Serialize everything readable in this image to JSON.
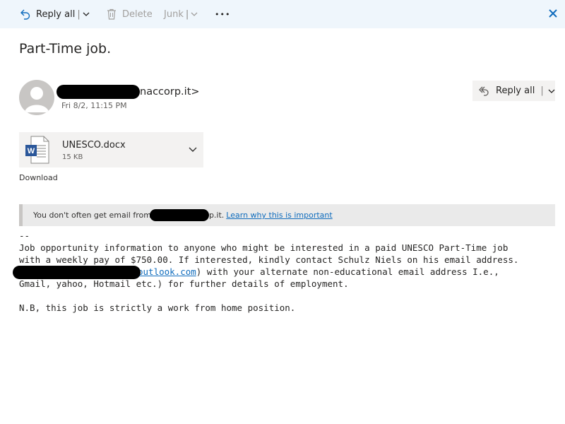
{
  "toolbar": {
    "reply_all": "Reply all",
    "delete": "Delete",
    "junk": "Junk",
    "more": "•••"
  },
  "email": {
    "subject": "Part-Time job.",
    "sender_visible": "naccorp.it>",
    "date": "Fri 8/2, 11:15 PM",
    "reply_all": "Reply all",
    "attachment": {
      "name": "UNESCO.docx",
      "size": "15 KB",
      "download": "Download"
    },
    "warning": {
      "text_prefix": "You don't often get email from",
      "text_suffix": "p.it.",
      "link": "Learn why this is important"
    },
    "body": {
      "line0": "--",
      "line1": "Job opportunity information to anyone who might be interested in a paid UNESCO Part-Time job",
      "line2": "with a weekly pay of $750.00. If interested, kindly contact Schulz Niels on his email address.",
      "line3_link": "outlook.com",
      "line3_rest": ") with your alternate non-educational email address I.e.,",
      "line4": "Gmail, yahoo, Hotmail etc.) for further details of employment.",
      "line5": "",
      "line6": "N.B, this job is strictly a work from home position."
    }
  }
}
